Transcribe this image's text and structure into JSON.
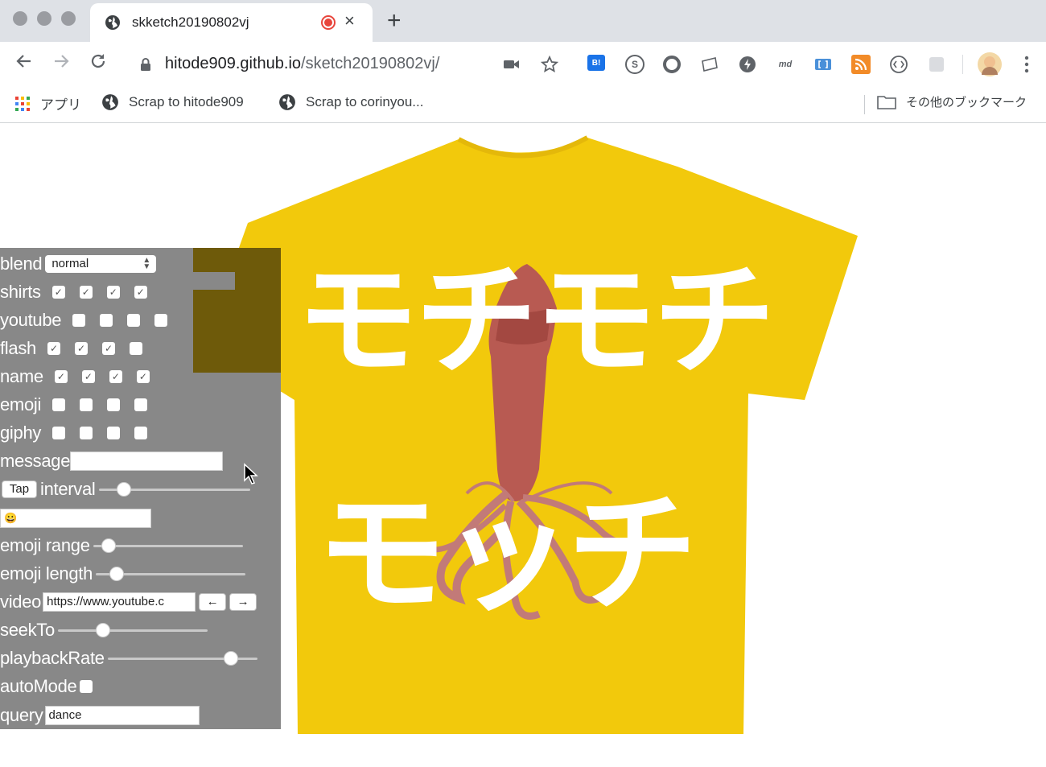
{
  "browser": {
    "tab_title": "skketch20190802vj",
    "tab_close": "×",
    "new_tab": "+",
    "url_host": "hitode909.github.io",
    "url_path": "/sketch20190802vj/",
    "bookmarks": {
      "apps_label": "アプリ",
      "item1": "Scrap to hitode909",
      "item2": "Scrap to corinyou...",
      "other": "その他のブックマーク"
    },
    "extensions": {
      "ext_b": "B!",
      "ext_s": "S",
      "ext_md": "md"
    }
  },
  "page": {
    "overlay_line1": "モチモチ",
    "overlay_line2": "モッチ"
  },
  "panel": {
    "blend_label": "blend",
    "blend_value": "normal",
    "shirts_label": "shirts",
    "youtube_label": "youtube",
    "flash_label": "flash",
    "name_label": "name",
    "emoji_label": "emoji",
    "giphy_label": "giphy",
    "message_label": "message",
    "message_value": "",
    "tap_label": "Tap",
    "interval_label": "interval",
    "emoji_field_value": "😀",
    "emoji_range_label": "emoji range",
    "emoji_length_label": "emoji length",
    "video_label": "video",
    "video_value": "https://www.youtube.c",
    "prev_label": "←",
    "next_label": "→",
    "seekto_label": "seekTo",
    "playbackrate_label": "playbackRate",
    "automode_label": "autoMode",
    "query_label": "query",
    "query_value": "dance",
    "checks": {
      "shirts": [
        true,
        true,
        true,
        true
      ],
      "youtube": [
        false,
        false,
        false,
        false
      ],
      "flash": [
        true,
        true,
        true,
        false
      ],
      "name": [
        true,
        true,
        true,
        true
      ],
      "emoji": [
        false,
        false,
        false,
        false
      ],
      "giphy": [
        false,
        false,
        false,
        false
      ],
      "automode": [
        false
      ]
    },
    "sliders": {
      "interval": 0.13,
      "emoji_range": 0.06,
      "emoji_length": 0.1,
      "seekto": 0.28,
      "playbackrate": 0.86
    },
    "check_glyph": "✓"
  }
}
